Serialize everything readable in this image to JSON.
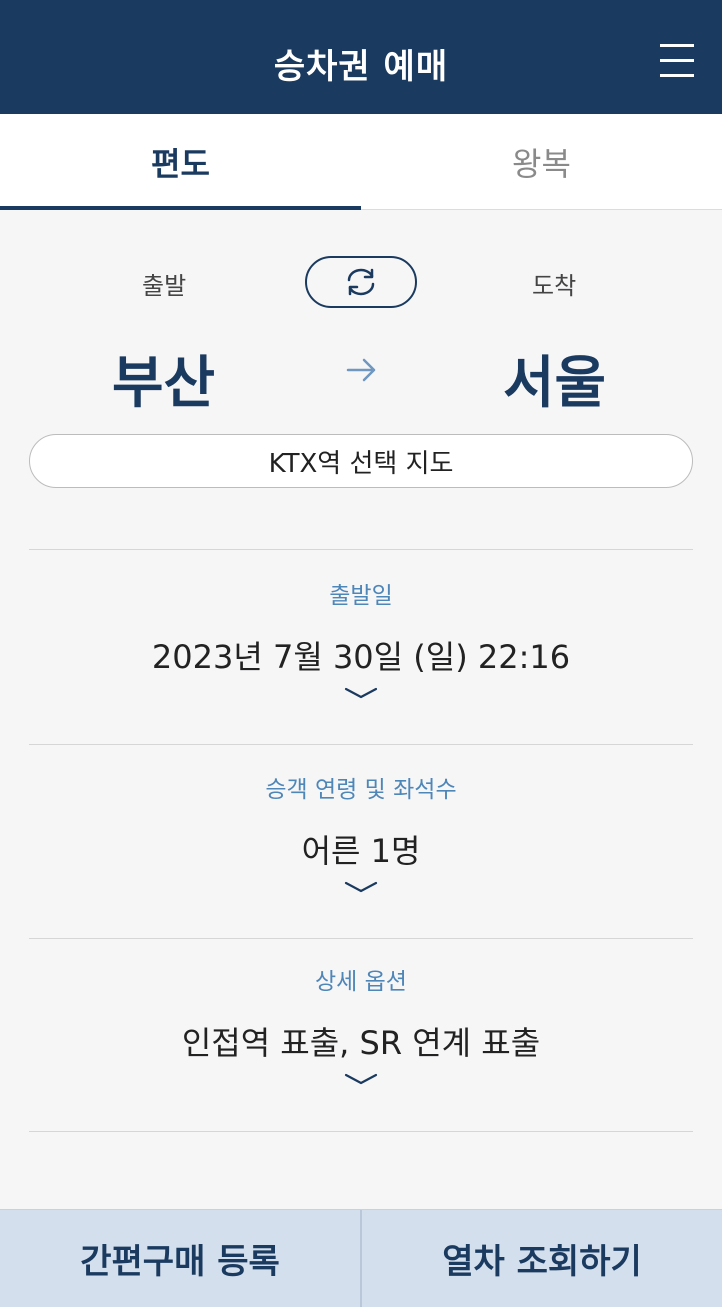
{
  "header": {
    "title": "승차권 예매"
  },
  "tabs": [
    {
      "label": "편도",
      "active": true
    },
    {
      "label": "왕복",
      "active": false
    }
  ],
  "route": {
    "departure_label": "출발",
    "arrival_label": "도착",
    "departure_station": "부산",
    "arrival_station": "서울"
  },
  "map_button": {
    "label": "KTX역 선택 지도"
  },
  "sections": {
    "date": {
      "label": "출발일",
      "value": "2023년 7월 30일 (일) 22:16"
    },
    "passengers": {
      "label": "승객 연령 및 좌석수",
      "value": "어른 1명"
    },
    "options": {
      "label": "상세 옵션",
      "value": "인접역 표출, SR 연계 표출"
    }
  },
  "bottom": {
    "left_label": "간편구매 등록",
    "right_label": "열차 조회하기"
  },
  "colors": {
    "primary": "#1a3a5f",
    "accent_label": "#4f86b8",
    "bottom_bar": "#d3dfec",
    "background": "#f6f6f7"
  }
}
